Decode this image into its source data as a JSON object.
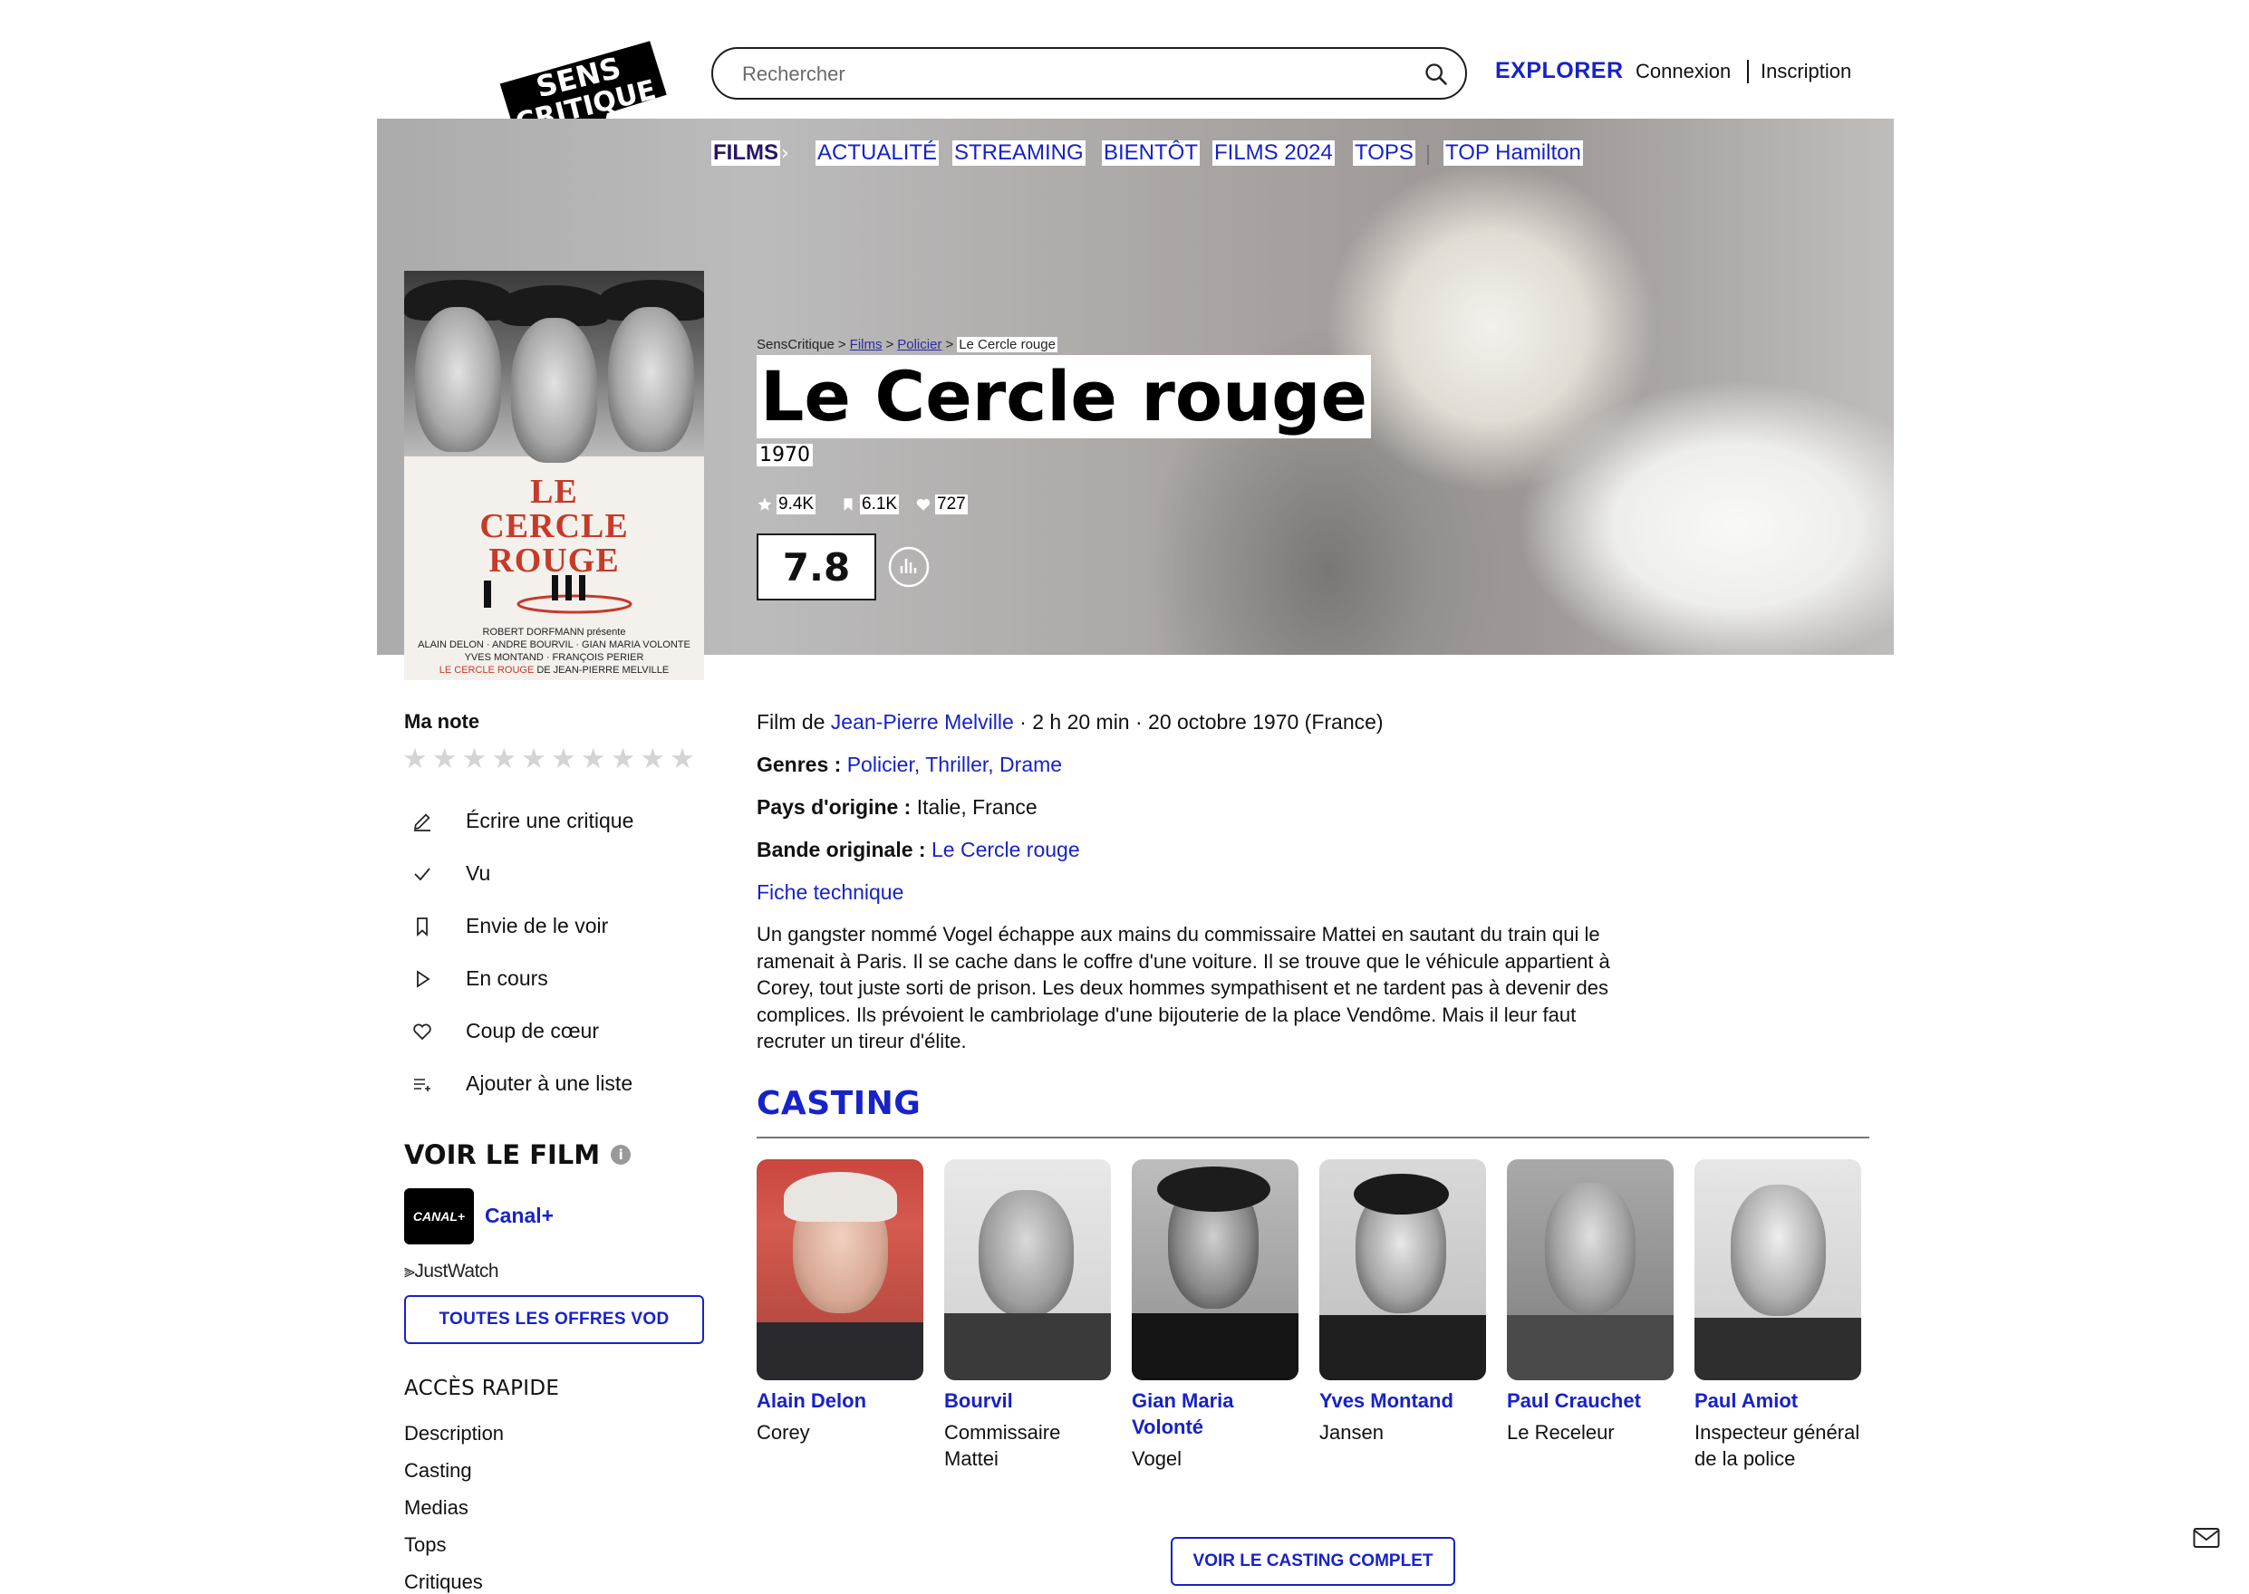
{
  "header": {
    "logo_line1": "SENS",
    "logo_line2": "CRITIQUE",
    "search_placeholder": "Rechercher",
    "explorer": "EXPLORER",
    "login": "Connexion",
    "signup": "Inscription"
  },
  "nav": {
    "films": "FILMS",
    "items": [
      "ACTUALITÉ",
      "STREAMING",
      "BIENTÔT",
      "FILMS 2024",
      "TOPS",
      "TOP Hamilton"
    ]
  },
  "breadcrumb": [
    "SensCritique",
    "Films",
    "Policier",
    "Le Cercle rouge"
  ],
  "film": {
    "title": "Le Cercle rouge",
    "year": "1970",
    "ratings_count": "9.4K",
    "wishlist_count": "6.1K",
    "favorites_count": "727",
    "score": "7.8"
  },
  "poster": {
    "title_line1": "LE",
    "title_line2": "CERCLE",
    "title_line3": "ROUGE",
    "credits_line1": "ROBERT DORFMANN présente",
    "credits_line2": "ALAIN DELON · ANDRE BOURVIL · GIAN MARIA VOLONTE",
    "credits_line3": "YVES MONTAND · FRANÇOIS PERIER",
    "credits_line4a": "LE CERCLE ROUGE",
    "credits_line4b": "DE JEAN-PIERRE MELVILLE"
  },
  "sidebar": {
    "my_rating": "Ma note",
    "actions": [
      "Écrire une critique",
      "Vu",
      "Envie de le voir",
      "En cours",
      "Coup de cœur",
      "Ajouter à une liste"
    ],
    "watch_title": "VOIR LE FILM",
    "info_glyph": "i",
    "provider_logo": "CANAL+",
    "provider_name": "Canal+",
    "justwatch": "JustWatch",
    "vod_button": "TOUTES LES OFFRES VOD",
    "quick_access_title": "ACCÈS RAPIDE",
    "quick_links": [
      "Description",
      "Casting",
      "Medias",
      "Tops",
      "Critiques"
    ]
  },
  "details": {
    "film_by_prefix": "Film de ",
    "director": "Jean-Pierre Melville",
    "meta": " · 2 h 20 min · 20 octobre 1970 (France)",
    "genres_label": "Genres : ",
    "genres": [
      "Policier",
      "Thriller",
      "Drame"
    ],
    "country_label": "Pays d'origine : ",
    "country": "Italie, France",
    "soundtrack_label": "Bande originale : ",
    "soundtrack": "Le Cercle rouge",
    "tech_sheet": "Fiche technique",
    "synopsis": "Un gangster nommé Vogel échappe aux mains du commissaire Mattei en sautant du train qui le ramenait à Paris. Il se cache dans le coffre d'une voiture. Il se trouve que le véhicule appartient à Corey, tout juste sorti de prison. Les deux hommes sympathisent et ne tardent pas à devenir des complices. Ils prévoient le cambriolage d'une bijouterie de la place Vendôme. Mais il leur faut recruter un tireur d'élite."
  },
  "casting": {
    "title": "CASTING",
    "actors": [
      {
        "name": "Alain Delon",
        "role": "Corey"
      },
      {
        "name": "Bourvil",
        "role": "Commissaire Mattei"
      },
      {
        "name": "Gian Maria Volonté",
        "role": "Vogel"
      },
      {
        "name": "Yves Montand",
        "role": "Jansen"
      },
      {
        "name": "Paul Crauchet",
        "role": "Le Receleur"
      },
      {
        "name": "Paul Amiot",
        "role": "Inspecteur général de la police"
      }
    ],
    "full_cast_button": "VOIR LE CASTING COMPLET"
  },
  "colors": {
    "accent": "#1722c8",
    "nav_active": "#2b1466",
    "poster_red": "#c63a2a"
  }
}
